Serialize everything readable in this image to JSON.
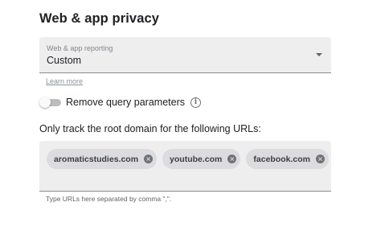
{
  "section": {
    "title": "Web & app privacy"
  },
  "reporting_select": {
    "label": "Web & app reporting",
    "value": "Custom"
  },
  "learn_more": "Learn more",
  "query_toggle": {
    "label": "Remove query parameters",
    "state": "off",
    "info_glyph": "i"
  },
  "root_domain": {
    "label": "Only track the root domain for the following URLs:",
    "chips": [
      {
        "text": "aromaticstudies.com",
        "remove_glyph": "×"
      },
      {
        "text": "youtube.com",
        "remove_glyph": "×"
      },
      {
        "text": "facebook.com",
        "remove_glyph": "×"
      }
    ],
    "helper": "Type URLs here separated by comma \",\"."
  },
  "colors": {
    "field_bg": "#eeeeef",
    "chip_bg": "#dcdcde",
    "text": "#202124",
    "muted": "#80868b"
  }
}
